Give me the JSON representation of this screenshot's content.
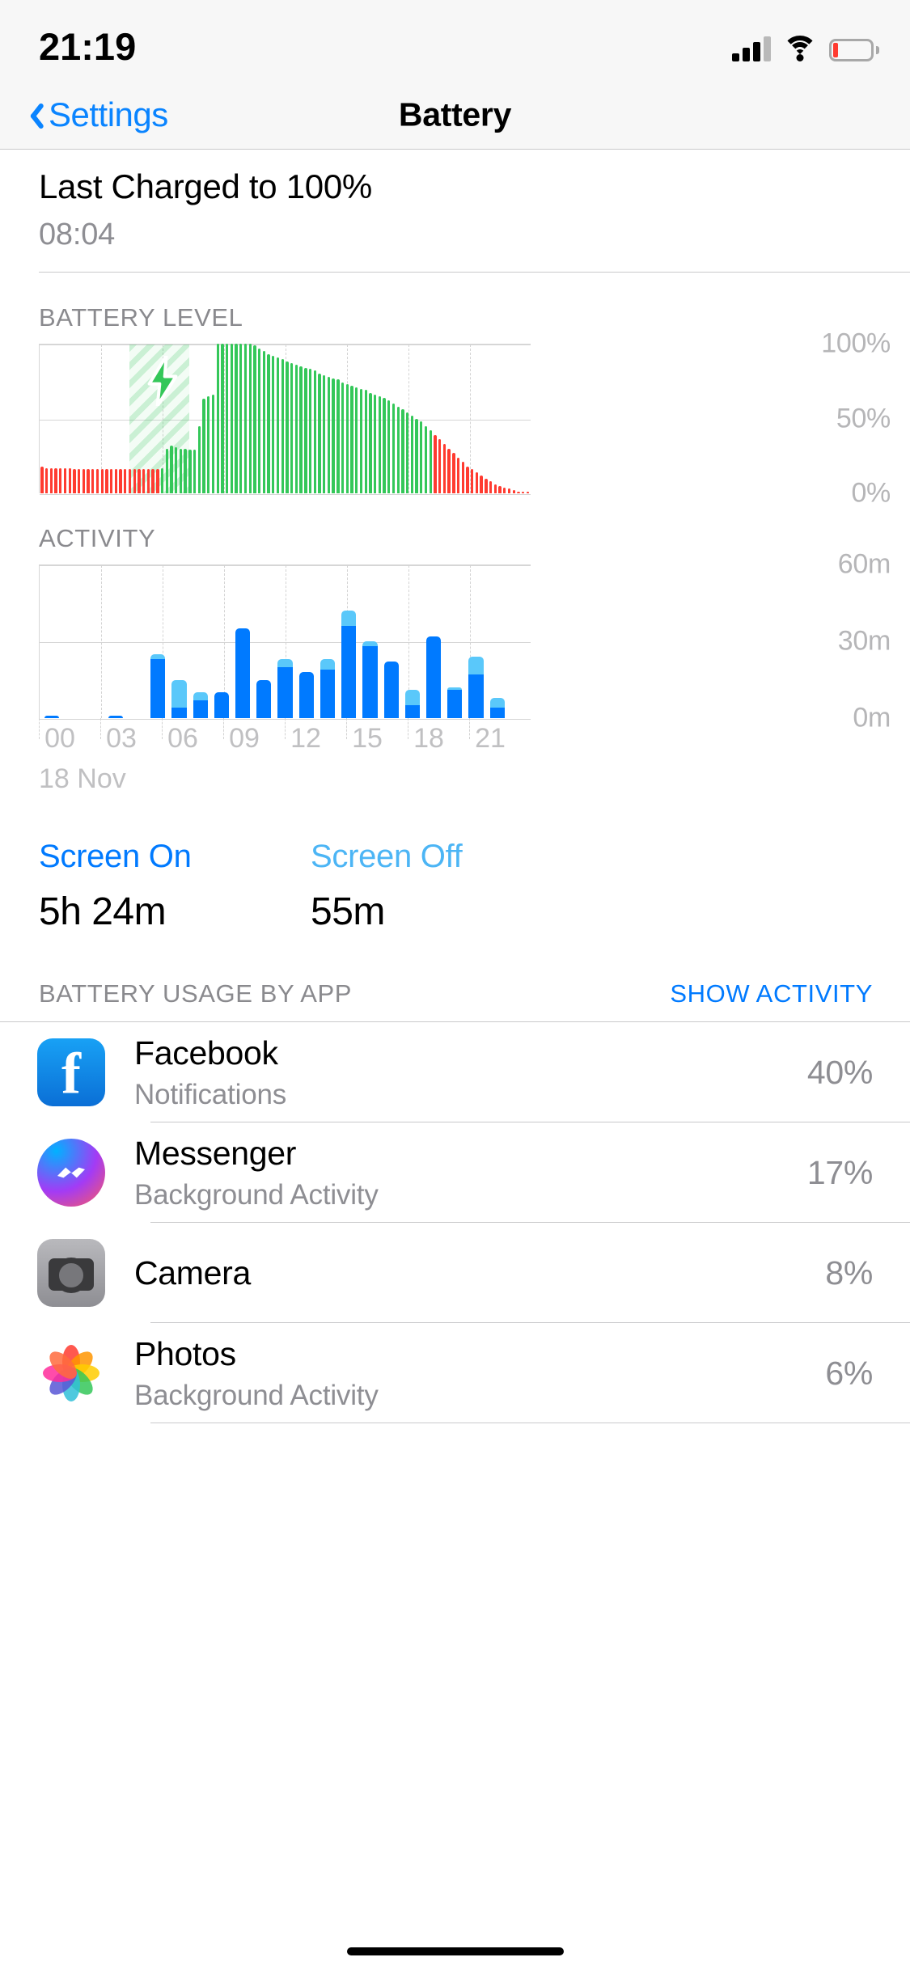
{
  "status_bar": {
    "time": "21:19",
    "cellular_icon": "cellular-signal-icon",
    "wifi_icon": "wifi-icon",
    "battery_icon": "battery-low-icon"
  },
  "nav": {
    "back_label": "Settings",
    "back_icon": "chevron-left-icon",
    "title": "Battery"
  },
  "last_charged": {
    "title": "Last Charged to 100%",
    "time": "08:04"
  },
  "battery_level": {
    "section_label": "BATTERY LEVEL",
    "y_labels": [
      "100%",
      "50%",
      "0%"
    ],
    "charging_icon": "lightning-bolt-icon",
    "colors": {
      "green": "#34c759",
      "red": "#ff3b30",
      "charge_band": "#34c759"
    }
  },
  "activity": {
    "section_label": "ACTIVITY",
    "y_labels": [
      "60m",
      "30m",
      "0m"
    ],
    "x_labels": [
      "00",
      "03",
      "06",
      "09",
      "12",
      "15",
      "18",
      "21"
    ],
    "date_label": "18 Nov",
    "colors": {
      "screen_on": "#007aff",
      "screen_off": "#5ac8fa"
    }
  },
  "screen_time": {
    "on_label": "Screen On",
    "on_value": "5h 24m",
    "off_label": "Screen Off",
    "off_value": "55m"
  },
  "usage": {
    "header": "BATTERY USAGE BY APP",
    "action": "SHOW ACTIVITY",
    "apps": [
      {
        "name": "Facebook",
        "subtitle": "Notifications",
        "percent": "40%",
        "icon": "facebook-icon"
      },
      {
        "name": "Messenger",
        "subtitle": "Background Activity",
        "percent": "17%",
        "icon": "messenger-icon"
      },
      {
        "name": "Camera",
        "subtitle": "",
        "percent": "8%",
        "icon": "camera-icon"
      },
      {
        "name": "Photos",
        "subtitle": "Background Activity",
        "percent": "6%",
        "icon": "photos-icon"
      }
    ]
  },
  "chart_data": [
    {
      "type": "bar",
      "title": "BATTERY LEVEL",
      "ylabel": "",
      "xlabel": "",
      "ylim": [
        0,
        100
      ],
      "ytick_labels": [
        "100%",
        "50%",
        "0%"
      ],
      "ytick_values": [
        100,
        50,
        0
      ],
      "xtick_labels": [
        "00",
        "03",
        "06",
        "09",
        "12",
        "15",
        "18",
        "21"
      ],
      "grid": true,
      "charging_span_hours": [
        4.4,
        7.3
      ],
      "values": [
        18,
        17,
        17,
        17,
        17,
        17,
        17,
        16,
        16,
        16,
        16,
        16,
        16,
        16,
        16,
        16,
        16,
        16,
        16,
        16,
        16,
        16,
        16,
        16,
        16,
        16,
        17,
        30,
        32,
        31,
        30,
        30,
        29,
        29,
        45,
        63,
        65,
        66,
        100,
        100,
        100,
        100,
        100,
        100,
        100,
        100,
        99,
        97,
        95,
        93,
        92,
        91,
        90,
        88,
        87,
        86,
        85,
        84,
        83,
        82,
        80,
        79,
        78,
        77,
        76,
        74,
        73,
        72,
        71,
        70,
        69,
        67,
        66,
        65,
        64,
        62,
        60,
        58,
        56,
        54,
        52,
        50,
        48,
        45,
        42,
        39,
        36,
        33,
        30,
        27,
        24,
        21,
        18,
        16,
        14,
        12,
        10,
        8,
        6,
        5,
        4,
        3,
        2,
        1,
        1,
        0
      ],
      "bar_colors": [
        "red",
        "red",
        "red",
        "red",
        "red",
        "red",
        "red",
        "red",
        "red",
        "red",
        "red",
        "red",
        "red",
        "red",
        "red",
        "red",
        "red",
        "red",
        "red",
        "red",
        "red",
        "red",
        "red",
        "red",
        "red",
        "red",
        "green",
        "green",
        "green",
        "green",
        "green",
        "green",
        "green",
        "green",
        "green",
        "green",
        "green",
        "green",
        "green",
        "green",
        "green",
        "green",
        "green",
        "green",
        "green",
        "green",
        "green",
        "green",
        "green",
        "green",
        "green",
        "green",
        "green",
        "green",
        "green",
        "green",
        "green",
        "green",
        "green",
        "green",
        "green",
        "green",
        "green",
        "green",
        "green",
        "green",
        "green",
        "green",
        "green",
        "green",
        "green",
        "green",
        "green",
        "green",
        "green",
        "green",
        "green",
        "green",
        "green",
        "green",
        "green",
        "green",
        "green",
        "green",
        "green",
        "red",
        "red",
        "red",
        "red",
        "red",
        "red",
        "red",
        "red",
        "red",
        "red",
        "red",
        "red",
        "red",
        "red",
        "red",
        "red",
        "red",
        "red",
        "red",
        "red",
        "red",
        "red",
        "red"
      ]
    },
    {
      "type": "bar",
      "title": "ACTIVITY",
      "stacked": true,
      "ylabel": "",
      "xlabel": "",
      "ylim": [
        0,
        60
      ],
      "ytick_labels": [
        "60m",
        "30m",
        "0m"
      ],
      "ytick_values": [
        60,
        30,
        0
      ],
      "xtick_labels": [
        "00",
        "03",
        "06",
        "09",
        "12",
        "15",
        "18",
        "21"
      ],
      "categories": [
        "00",
        "01",
        "02",
        "03",
        "04",
        "05",
        "06",
        "07",
        "08",
        "09",
        "10",
        "11",
        "12",
        "13",
        "14",
        "15",
        "16",
        "17",
        "18",
        "19",
        "20",
        "21",
        "22"
      ],
      "grid": true,
      "series": [
        {
          "name": "Screen On",
          "color": "#007aff",
          "values": [
            1,
            0,
            0,
            1,
            0,
            23,
            4,
            7,
            10,
            35,
            15,
            20,
            18,
            19,
            36,
            28,
            22,
            5,
            32,
            11,
            17,
            4,
            0
          ]
        },
        {
          "name": "Screen Off",
          "color": "#5ac8fa",
          "values": [
            0,
            0,
            0,
            0,
            0,
            2,
            11,
            3,
            0,
            0,
            0,
            3,
            0,
            4,
            6,
            2,
            0,
            6,
            0,
            1,
            7,
            4,
            0
          ]
        }
      ]
    }
  ]
}
